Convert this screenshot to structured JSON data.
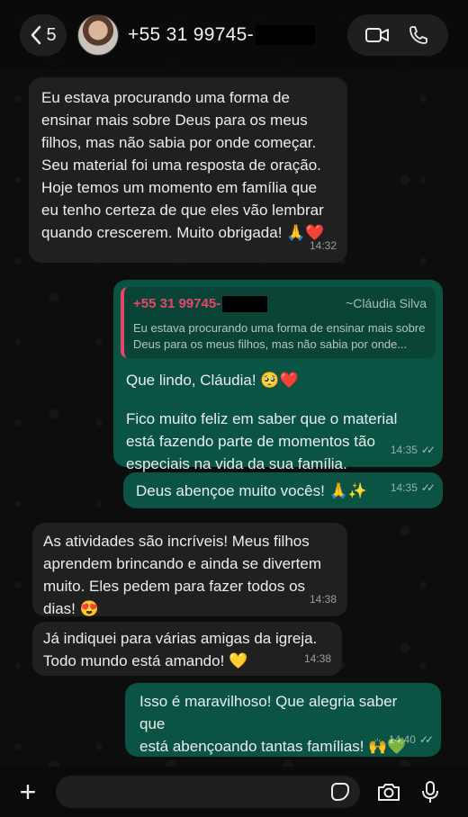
{
  "header": {
    "back_count": "5",
    "contact_number": "+55 31 99745-"
  },
  "messages": [
    {
      "direction": "in",
      "text": "Eu estava procurando uma forma de\nensinar mais sobre Deus para os meus\nfilhos, mas não sabia por onde começar.\nSeu material foi uma resposta de oração.\nHoje temos um momento em família que\neu tenho certeza de que eles vão lembrar\nquando crescerem. Muito obrigada! 🙏❤️",
      "time": "14:32"
    },
    {
      "direction": "out",
      "quote": {
        "number": "+55 31 99745-",
        "name": "~Cláudia Silva",
        "text": "Eu estava procurando uma forma de ensinar mais sobre\nDeus para os meus filhos, mas não sabia por onde..."
      },
      "text1": "Que lindo, Cláudia! 🥺❤️",
      "text2": "Fico muito feliz em saber que o material\nestá fazendo parte de momentos tão\nespeciais na vida da sua família.",
      "time": "14:35"
    },
    {
      "direction": "out",
      "text": "Deus abençoe muito vocês! 🙏✨",
      "time": "14:35"
    },
    {
      "direction": "in",
      "text": "As atividades são incríveis! Meus filhos\naprendem brincando e ainda se divertem\nmuito. Eles pedem para fazer todos os\ndias! 😍",
      "time": "14:38"
    },
    {
      "direction": "in",
      "text": "Já indiquei para várias amigas da igreja.\nTodo mundo está amando! 💛",
      "time": "14:38"
    },
    {
      "direction": "out",
      "text": "Isso é maravilhoso! Que alegria saber que\nestá abençoando tantas famílias! 🙌💚",
      "time": "14:40"
    }
  ],
  "colors": {
    "incoming": "#202020",
    "outgoing": "#0b5443",
    "quote_accent": "#e5476b"
  },
  "icons": [
    "chevron-left-icon",
    "video-call-icon",
    "phone-icon",
    "plus-icon",
    "sticker-icon",
    "camera-icon",
    "microphone-icon",
    "double-check-icon"
  ]
}
